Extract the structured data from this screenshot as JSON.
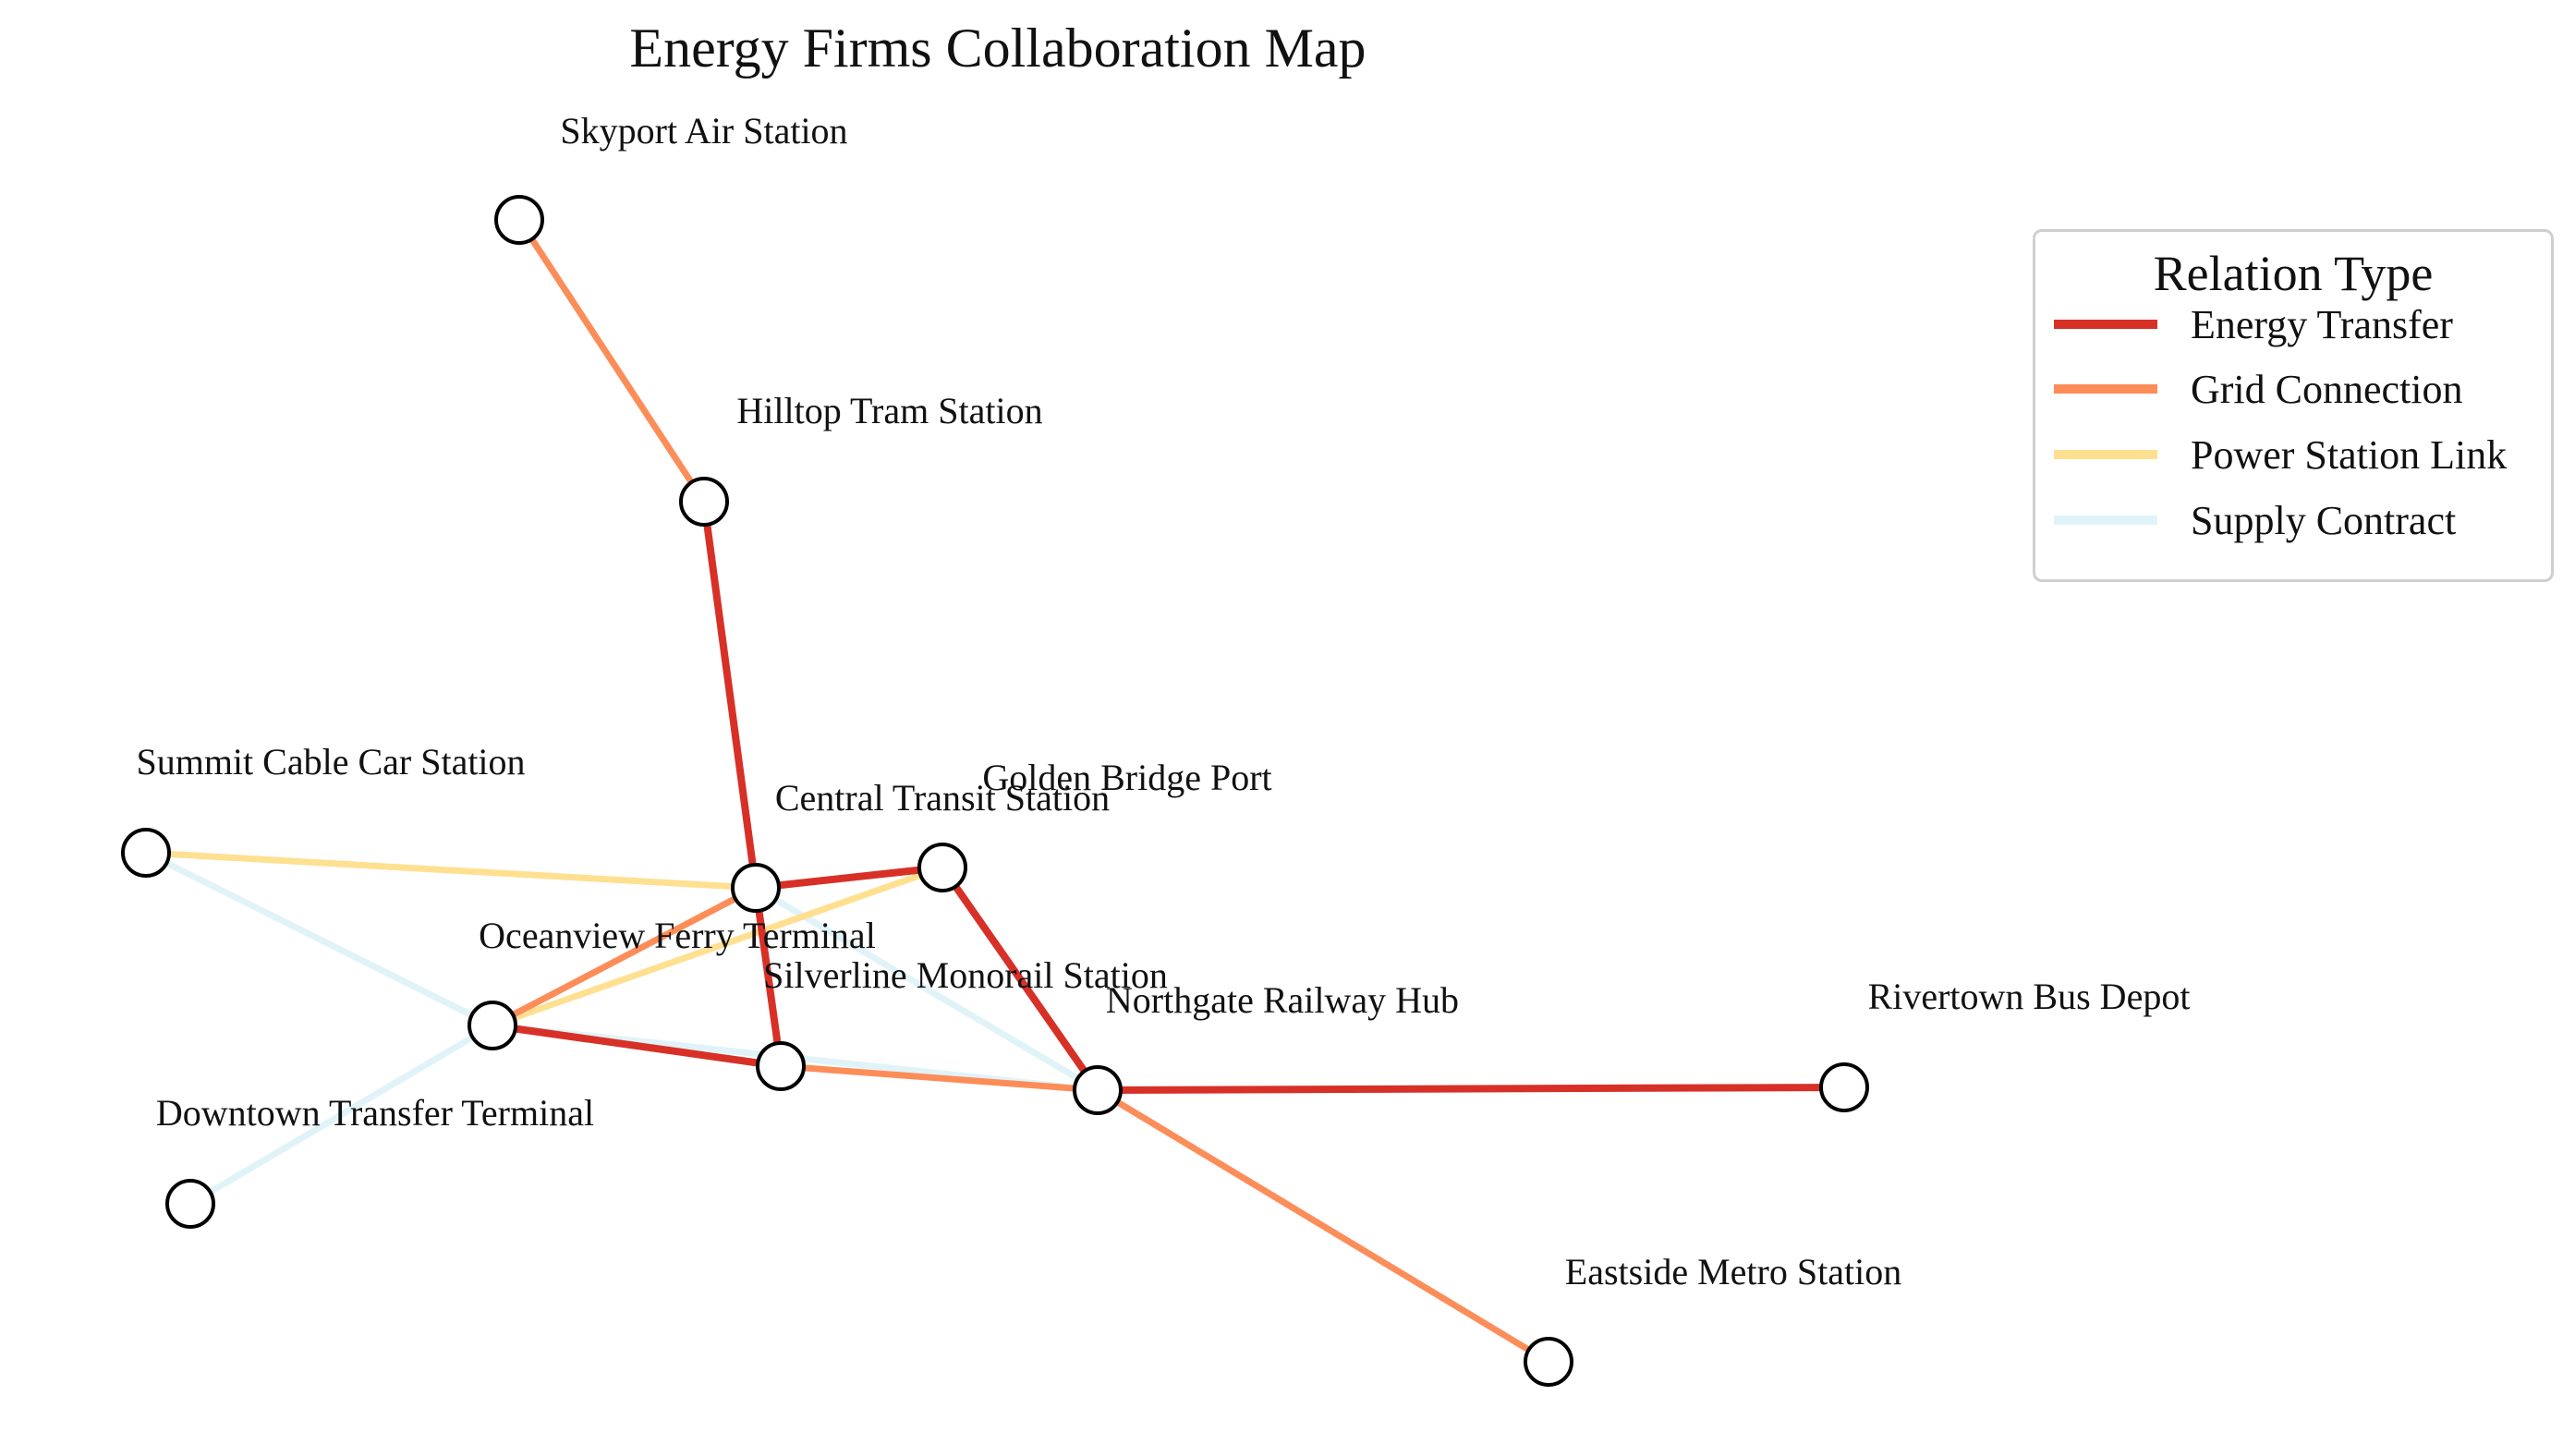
{
  "title": "Energy Firms Collaboration Map",
  "legend": {
    "title": "Relation Type",
    "items": [
      {
        "label": "Energy Transfer",
        "color": "#d73027"
      },
      {
        "label": "Grid Connection",
        "color": "#fc8d59"
      },
      {
        "label": "Power Station Link",
        "color": "#fee090"
      },
      {
        "label": "Supply Contract",
        "color": "#e0f3f8"
      }
    ]
  },
  "nodes": [
    {
      "id": "skyport",
      "label": "Skyport Air Station"
    },
    {
      "id": "hilltop",
      "label": "Hilltop Tram Station"
    },
    {
      "id": "summit",
      "label": "Summit Cable Car Station"
    },
    {
      "id": "central",
      "label": "Central Transit Station"
    },
    {
      "id": "golden",
      "label": "Golden Bridge Port"
    },
    {
      "id": "oceanview",
      "label": "Oceanview Ferry Terminal"
    },
    {
      "id": "silverline",
      "label": "Silverline Monorail Station"
    },
    {
      "id": "northgate",
      "label": "Northgate Railway Hub"
    },
    {
      "id": "rivertown",
      "label": "Rivertown Bus Depot"
    },
    {
      "id": "downtown",
      "label": "Downtown Transfer Terminal"
    },
    {
      "id": "eastside",
      "label": "Eastside Metro Station"
    }
  ],
  "edges": [
    {
      "source": "skyport",
      "target": "hilltop",
      "type": "Grid Connection"
    },
    {
      "source": "hilltop",
      "target": "central",
      "type": "Energy Transfer"
    },
    {
      "source": "central",
      "target": "golden",
      "type": "Energy Transfer"
    },
    {
      "source": "central",
      "target": "silverline",
      "type": "Energy Transfer"
    },
    {
      "source": "golden",
      "target": "northgate",
      "type": "Energy Transfer"
    },
    {
      "source": "northgate",
      "target": "rivertown",
      "type": "Energy Transfer"
    },
    {
      "source": "oceanview",
      "target": "silverline",
      "type": "Energy Transfer"
    },
    {
      "source": "central",
      "target": "oceanview",
      "type": "Grid Connection"
    },
    {
      "source": "silverline",
      "target": "northgate",
      "type": "Grid Connection"
    },
    {
      "source": "northgate",
      "target": "eastside",
      "type": "Grid Connection"
    },
    {
      "source": "summit",
      "target": "central",
      "type": "Power Station Link"
    },
    {
      "source": "golden",
      "target": "oceanview",
      "type": "Power Station Link"
    },
    {
      "source": "summit",
      "target": "oceanview",
      "type": "Supply Contract"
    },
    {
      "source": "oceanview",
      "target": "downtown",
      "type": "Supply Contract"
    },
    {
      "source": "oceanview",
      "target": "northgate",
      "type": "Supply Contract"
    },
    {
      "source": "central",
      "target": "northgate",
      "type": "Supply Contract"
    }
  ]
}
